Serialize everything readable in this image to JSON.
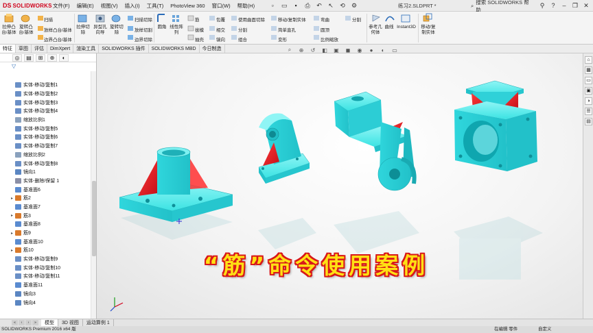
{
  "app": {
    "brand": "SOLIDWORKS",
    "brand_mark": "DS",
    "document_title": "练习2.SLDPRT *"
  },
  "menu": [
    "文件(F)",
    "编辑(E)",
    "视图(V)",
    "插入(I)",
    "工具(T)",
    "PhotoView 360",
    "窗口(W)",
    "帮助(H)"
  ],
  "help_search": {
    "placeholder": "搜索 SOLIDWORKS 帮助"
  },
  "ribbon": {
    "boss_extrude": "拉伸凸台/基体",
    "revolve_boss": "旋转凸台/基体",
    "sweep": "扫描",
    "loft": "放样凸台/基体",
    "boundary_boss": "边界凸台/基体",
    "extruded_cut": "拉伸切除",
    "hole_wizard": "异型孔向导",
    "revolved_cut": "旋转切除",
    "swept_cut": "扫描切除",
    "lofted_cut": "放样切割",
    "boundary_cut": "边界切除",
    "fillet": "圆角",
    "linear_pattern": "线性阵列",
    "rib": "筋",
    "draft": "拔模",
    "shell": "抽壳",
    "wrap": "包覆",
    "intersect": "相交",
    "mirror": "镜向",
    "use_surface_cut": "使用曲面切除",
    "split": "分割",
    "combine": "组合",
    "move_copy_body": "移动/复制实体",
    "simple_hole": "简单直孔",
    "deform": "变形",
    "indent": "压凹",
    "dome": "圆顶",
    "flex": "弯曲",
    "scale": "比例缩放",
    "split2": "分割",
    "ref_geometry": "参考几何体",
    "curves": "曲线",
    "instant3d": "Instant3D",
    "move_copy_body2": "移动/复制实体"
  },
  "command_tabs": [
    {
      "label": "特征",
      "active": true
    },
    {
      "label": "草图",
      "active": false
    },
    {
      "label": "评估",
      "active": false
    },
    {
      "label": "DimXpert",
      "active": false
    },
    {
      "label": "渲染工具",
      "active": false
    },
    {
      "label": "SOLIDWORKS 插件",
      "active": false
    },
    {
      "label": "SOLIDWORKS MBD",
      "active": false
    },
    {
      "label": "今日制造",
      "active": false
    }
  ],
  "feature_tree": {
    "items": [
      {
        "label": "实体-移动/复制1",
        "expand": "",
        "icon": "move-body-icon"
      },
      {
        "label": "实体-移动/复制2",
        "expand": "",
        "icon": "move-body-icon"
      },
      {
        "label": "实体-移动/复制3",
        "expand": "",
        "icon": "move-body-icon"
      },
      {
        "label": "实体-移动/复制4",
        "expand": "",
        "icon": "move-body-icon"
      },
      {
        "label": "缩放比例1",
        "expand": "",
        "icon": "scale-icon"
      },
      {
        "label": "实体-移动/复制5",
        "expand": "",
        "icon": "move-body-icon"
      },
      {
        "label": "实体-移动/复制6",
        "expand": "",
        "icon": "move-body-icon"
      },
      {
        "label": "实体-移动/复制7",
        "expand": "",
        "icon": "move-body-icon"
      },
      {
        "label": "缩放比例2",
        "expand": "",
        "icon": "scale-icon"
      },
      {
        "label": "实体-移动/复制8",
        "expand": "",
        "icon": "move-body-icon"
      },
      {
        "label": "镜向1",
        "expand": "",
        "icon": "mirror-icon"
      },
      {
        "label": "实体-删除/保留 1",
        "expand": "",
        "icon": "delete-body-icon"
      },
      {
        "label": "基准面6",
        "expand": "",
        "icon": "plane-icon"
      },
      {
        "label": "筋2",
        "expand": "▸",
        "icon": "rib-icon"
      },
      {
        "label": "基准面7",
        "expand": "",
        "icon": "plane-icon"
      },
      {
        "label": "筋3",
        "expand": "▸",
        "icon": "rib-icon"
      },
      {
        "label": "基准面8",
        "expand": "",
        "icon": "plane-icon"
      },
      {
        "label": "筋9",
        "expand": "▸",
        "icon": "rib-icon"
      },
      {
        "label": "基准面10",
        "expand": "",
        "icon": "plane-icon"
      },
      {
        "label": "筋10",
        "expand": "▸",
        "icon": "rib-icon"
      },
      {
        "label": "实体-移动/复制9",
        "expand": "",
        "icon": "move-body-icon"
      },
      {
        "label": "实体-移动/复制10",
        "expand": "",
        "icon": "move-body-icon"
      },
      {
        "label": "实体-移动/复制11",
        "expand": "",
        "icon": "move-body-icon"
      },
      {
        "label": "基准面11",
        "expand": "",
        "icon": "plane-icon"
      },
      {
        "label": "镜向3",
        "expand": "",
        "icon": "mirror-icon"
      },
      {
        "label": "镜向4",
        "expand": "",
        "icon": "mirror-icon"
      }
    ]
  },
  "viewport": {
    "caption": "“筋”命令使用案例"
  },
  "bottom_tabs": [
    {
      "label": "模型",
      "active": true
    },
    {
      "label": "3D 视图",
      "active": false
    },
    {
      "label": "运动算例 1",
      "active": false
    }
  ],
  "status": {
    "left": "SOLIDWORKS Premium 2016 x64 版",
    "mode": "在编辑 零件",
    "units": "自定义"
  },
  "colors": {
    "part": "#33e6e6",
    "rib": "#e0202a",
    "brand": "#d0021b",
    "caption_fill": "#ffe014",
    "caption_outline": "#d8181a"
  }
}
